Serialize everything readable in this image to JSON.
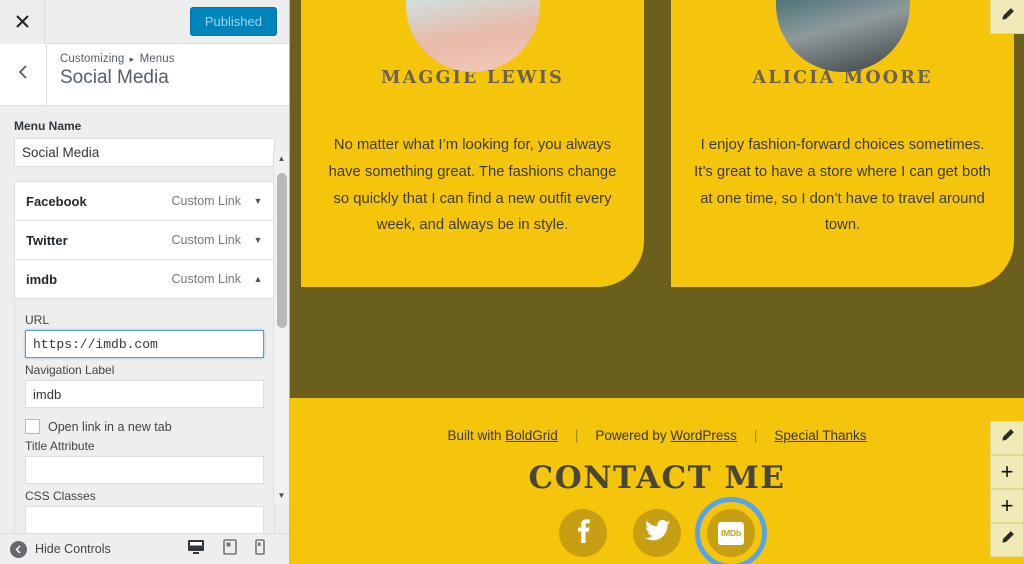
{
  "sidebar": {
    "close_icon": "close-icon",
    "publish_button": "Published",
    "back_icon": "chevron-left-icon",
    "breadcrumb_root": "Customizing",
    "breadcrumb_sep": "▸",
    "breadcrumb_section": "Menus",
    "panel_title": "Social Media",
    "menu_name_label": "Menu Name",
    "menu_name_value": "Social Media",
    "menu_items": [
      {
        "name": "Facebook",
        "type": "Custom Link",
        "arrow": "▼",
        "expanded": false
      },
      {
        "name": "Twitter",
        "type": "Custom Link",
        "arrow": "▼",
        "expanded": false
      },
      {
        "name": "imdb",
        "type": "Custom Link",
        "arrow": "▲",
        "expanded": true
      }
    ],
    "item_form": {
      "url_label": "URL",
      "url_value": "https://imdb.com",
      "nav_label_label": "Navigation Label",
      "nav_label_value": "imdb",
      "new_tab_label": "Open link in a new tab",
      "new_tab_checked": false,
      "title_attr_label": "Title Attribute",
      "title_attr_value": "",
      "css_classes_label": "CSS Classes",
      "css_classes_value": ""
    },
    "footer": {
      "hide_controls_label": "Hide Controls",
      "devices": [
        {
          "name": "desktop",
          "active": true
        },
        {
          "name": "tablet",
          "active": false
        },
        {
          "name": "mobile",
          "active": false
        }
      ]
    },
    "scrollbar": {
      "up_arrow": "▲",
      "down_arrow": "▼"
    }
  },
  "preview": {
    "testimonials": [
      {
        "name": "MAGGIE LEWIS",
        "quote": "No matter what I’m looking for, you always have something great. The fashions change so quickly that I can find a new outfit every week, and always be in style."
      },
      {
        "name": "ALICIA MOORE",
        "quote": "I enjoy fashion-forward choices sometimes. It’s great to have a store where I can get both at one time, so I don’t have to travel around town."
      }
    ],
    "footer": {
      "credits": [
        {
          "prefix": "Built with ",
          "link": "BoldGrid"
        },
        {
          "prefix": "Powered by ",
          "link": "WordPress"
        },
        {
          "prefix": "",
          "link": "Special Thanks"
        }
      ],
      "divider": "|",
      "contact_title": "CONTACT ME",
      "socials": [
        {
          "name": "facebook",
          "glyph": "f",
          "selected": false
        },
        {
          "name": "twitter",
          "glyph": "",
          "selected": false
        },
        {
          "name": "imdb",
          "glyph": "IMDb",
          "selected": true
        }
      ]
    },
    "edit_buttons": [
      {
        "name": "edit-pencil-top",
        "icon": "pencil-icon"
      },
      {
        "name": "edit-pencil-1",
        "icon": "pencil-icon"
      },
      {
        "name": "add-section-1",
        "icon": "plus-icon",
        "label": "+"
      },
      {
        "name": "add-section-2",
        "icon": "plus-icon",
        "label": "+"
      },
      {
        "name": "edit-pencil-2",
        "icon": "pencil-icon"
      }
    ]
  },
  "colors": {
    "accent_yellow": "#f5c50c",
    "dark_olive": "#6b5f1e",
    "publish_blue": "#0085ba",
    "selection_blue": "#56a5e8",
    "social_circle": "#c79f12"
  }
}
